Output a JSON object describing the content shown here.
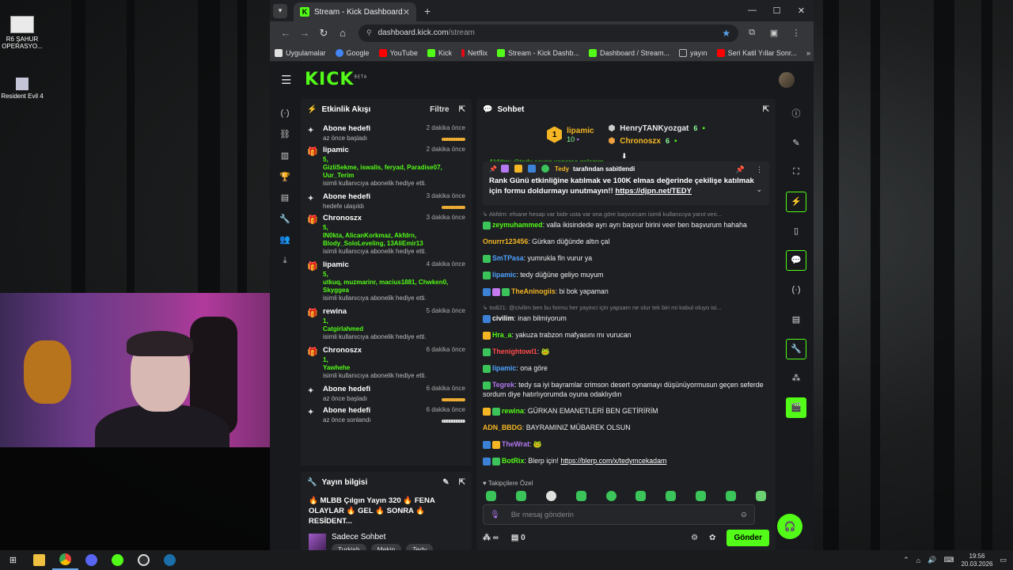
{
  "desktop": {
    "icons": [
      {
        "label": "R6 ŞAHUR OPERASYO..."
      },
      {
        "label": "Resident Evil 4"
      }
    ]
  },
  "browser": {
    "tab_title": "Stream - Kick Dashboard",
    "url_domain": "dashboard.kick.com",
    "url_path": "/stream",
    "bookmarks": [
      {
        "label": "Uygulamalar",
        "color": "#e0e0e0"
      },
      {
        "label": "Google",
        "color": "#4285f4"
      },
      {
        "label": "YouTube",
        "color": "#ff0000"
      },
      {
        "label": "Kick",
        "color": "#53fc18"
      },
      {
        "label": "Netflix",
        "color": "#e50914"
      },
      {
        "label": "Stream - Kick Dashb...",
        "color": "#53fc18"
      },
      {
        "label": "Dashboard / Stream...",
        "color": "#53fc18"
      },
      {
        "label": "yayın",
        "color": "#bbbbbb"
      },
      {
        "label": "Seri Katil Yıllar Sonr...",
        "color": "#ff0000"
      }
    ]
  },
  "kick": {
    "logo": "KICK",
    "logo_tag": "BETA",
    "activity": {
      "title": "Etkinlik Akışı",
      "filter_label": "Filtre",
      "items": [
        {
          "icon": "sparkle",
          "title": "Abone hedefi",
          "time": "2 dakika önce",
          "sub": "az önce başladı",
          "progress": "orange"
        },
        {
          "icon": "gift",
          "title": "lipamic",
          "time": "2 dakika önce",
          "count": "5,",
          "names": "GizliSekme, iswalis, feryad, Paradise07, Uur_Terim",
          "sub": "isimli kullanıcıya abonelik hediye etti."
        },
        {
          "icon": "sparkle",
          "title": "Abone hedefi",
          "time": "3 dakika önce",
          "sub": "hedefe ulaşıldı",
          "progress": "orange"
        },
        {
          "icon": "gift",
          "title": "Chronoszx",
          "time": "3 dakika önce",
          "count": "5,",
          "names": "IN0kta, AlicanKorkmaz, Akfdrn, Blody_SoloLeveling, 13AliEmir13",
          "sub": "isimli kullanıcıya abonelik hediye etti."
        },
        {
          "icon": "gift",
          "title": "lipamic",
          "time": "4 dakika önce",
          "count": "5,",
          "names": "utkuq, muzmarinr, macius1881, Chwken0, Skyggea",
          "sub": "isimli kullanıcıya abonelik hediye etti."
        },
        {
          "icon": "gift",
          "title": "rewina",
          "time": "5 dakika önce",
          "count": "1,",
          "names": "Catgirlahmed",
          "sub": "isimli kullanıcıya abonelik hediye etti."
        },
        {
          "icon": "gift",
          "title": "Chronoszx",
          "time": "6 dakika önce",
          "count": "1,",
          "names": "Yawhehe",
          "sub": "isimli kullanıcıya abonelik hediye etti."
        },
        {
          "icon": "sparkle",
          "title": "Abone hedefi",
          "time": "6 dakika önce",
          "sub": "az önce başladı",
          "progress": "orange"
        },
        {
          "icon": "sparkle",
          "title": "Abone hedefi",
          "time": "6 dakika önce",
          "sub": "az önce sonlandı",
          "progress": "gray"
        }
      ]
    },
    "stream_info": {
      "title": "Yayın bilgisi",
      "stream_title": "🔥 MLBB Çılgın Yayın 320 🔥 FENA OLAYLAR 🔥 GEL 🔥 SONRA 🔥 RESİDENT...",
      "category": "Sadece Sohbet",
      "tags": [
        "Turkish",
        "Mekin",
        "Tedy"
      ]
    },
    "chat": {
      "title": "Sohbet",
      "leaders": {
        "top": {
          "rank": "1",
          "name": "lipamic",
          "count": "10"
        },
        "others": [
          {
            "name": "HenryTANKyozgat",
            "count": "6",
            "color": "#ffffff"
          },
          {
            "name": "Chronoszx",
            "count": "6",
            "color": "#f5b625"
          }
        ]
      },
      "scrolled_text": "Akfdrn: @tedy seyan yaparsa gelsmm",
      "pinned": {
        "by": "Tedy",
        "by_suffix": "tarafından sabitlendi",
        "text": "Rank Günü etkinliğine katılmak ve 100K elmas değerinde çekilişe katılmak için formu doldurmayı unutmayın!!",
        "link": "https://djpn.net/TEDY"
      },
      "messages": [
        {
          "reply": "Akfdrn: efsane hesap var bide usta var ona göre başvurcam isimli kullanıcıya yanıt veri...",
          "user": "zeymuhammed",
          "color": "#53fc18",
          "text": "valla ikisindede ayrı ayrı başvur birini veer ben başvurum hahaha",
          "badges": [
            "#3bc45a"
          ]
        },
        {
          "user": "Onurrr123456",
          "color": "#f5b625",
          "text": "Gürkan düğünde altın çal",
          "badges": []
        },
        {
          "user": "SmTPasa",
          "color": "#4fa3ff",
          "text": "yumrukla fln vurur ya",
          "badges": [
            "#3bc45a"
          ]
        },
        {
          "user": "lipamic",
          "color": "#4fa3ff",
          "text": "tedy düğüne geliyo muyum",
          "badges": [
            "#3bc45a"
          ]
        },
        {
          "user": "TheAninogiis",
          "color": "#f5b625",
          "text": "bi bok yapaman",
          "badges": [
            "#3b82d6",
            "#c57af0",
            "#3bc45a"
          ]
        },
        {
          "reply": "todi21: @civilim ben bu formu her yayinci için yapsam ne olur tek biri mi kabul oluyo isi...",
          "user": "civilim",
          "color": "#ffffff",
          "text": "inan bilmiyorum",
          "badges": [
            "#3b82d6"
          ]
        },
        {
          "user": "Hra_a",
          "color": "#53fc18",
          "text": "yakuza trabzon mafyasını mı vurucan",
          "badges": [
            "#f5b625"
          ]
        },
        {
          "user": "Thenightowl1",
          "color": "#ff4a4a",
          "text": "🐸",
          "badges": [
            "#3bc45a"
          ]
        },
        {
          "user": "lipamic",
          "color": "#4fa3ff",
          "text": "ona göre",
          "badges": [
            "#3bc45a"
          ]
        },
        {
          "user": "Tegrek",
          "color": "#b478f0",
          "text": "tedy sa iyi bayramlar crimson desert oynamayı düşünüyormusun geçen seferde sordum diye hatırlıyorumda oyuna odaklıydın",
          "badges": [
            "#3bc45a"
          ]
        },
        {
          "user": "rewina",
          "color": "#53fc18",
          "text": "GÜRKAN EMANETLERİ BEN GETİRİRİM",
          "badges": [
            "#f5b625",
            "#3bc45a"
          ]
        },
        {
          "user": "ADN_BBDG",
          "color": "#f5b625",
          "text": "BAYRAMINIZ MÜBAREK OLSUN",
          "badges": []
        },
        {
          "user": "TheWrat",
          "color": "#b478f0",
          "text": "🐸",
          "badges": [
            "#3b82d6",
            "#f5b625"
          ]
        },
        {
          "user": "BotRix",
          "color": "#53fc18",
          "text": "Blerp için! ",
          "link": "https://blerp.com/x/tedymcekadam",
          "badges": [
            "#3b82d6",
            "#3bc45a"
          ]
        }
      ],
      "emote_label": "♥ Takipçilere Özel",
      "input_placeholder": "Bir mesaj gönderin",
      "count": "0",
      "send_label": "Gönder"
    }
  },
  "taskbar": {
    "time": "19:56",
    "date": "20.03.2026"
  },
  "colors": {
    "kick_green": "#53fc18",
    "gold": "#f5b625"
  }
}
